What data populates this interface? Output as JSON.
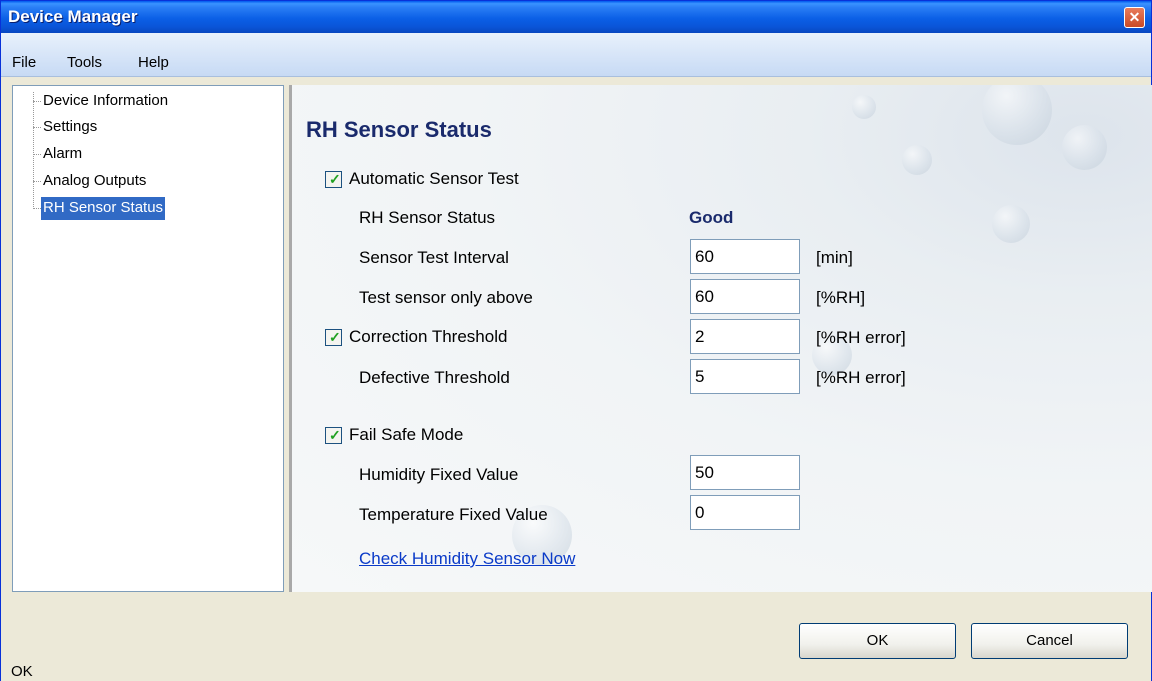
{
  "window": {
    "title": "Device Manager",
    "close_icon": "close-icon"
  },
  "menu": {
    "file": "File",
    "tools": "Tools",
    "help": "Help"
  },
  "tree": {
    "items": [
      {
        "label": "Device Information",
        "selected": false
      },
      {
        "label": "Settings",
        "selected": false
      },
      {
        "label": "Alarm",
        "selected": false
      },
      {
        "label": "Analog Outputs",
        "selected": false
      },
      {
        "label": "RH Sensor Status",
        "selected": true
      }
    ]
  },
  "panel": {
    "heading": "RH Sensor Status",
    "auto_test": {
      "label": "Automatic Sensor Test",
      "checked": true
    },
    "sensor_status": {
      "label": "RH Sensor Status",
      "value": "Good"
    },
    "test_interval": {
      "label": "Sensor Test Interval",
      "value": "60",
      "unit": "[min]"
    },
    "test_above": {
      "label": "Test sensor only above",
      "value": "60",
      "unit": "[%RH]"
    },
    "correction": {
      "label": "Correction Threshold",
      "checked": true,
      "value": "2",
      "unit": "[%RH error]"
    },
    "defective": {
      "label": "Defective Threshold",
      "value": "5",
      "unit": "[%RH error]"
    },
    "fail_safe": {
      "label": "Fail Safe Mode",
      "checked": true
    },
    "humidity_fixed": {
      "label": "Humidity Fixed Value",
      "value": "50"
    },
    "temperature_fixed": {
      "label": "Temperature Fixed Value",
      "value": "0"
    },
    "check_link": "Check Humidity Sensor Now"
  },
  "buttons": {
    "ok": "OK",
    "cancel": "Cancel"
  },
  "statusbar": {
    "text": "OK"
  }
}
